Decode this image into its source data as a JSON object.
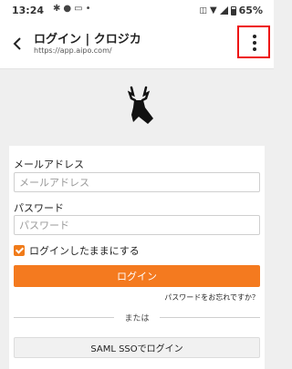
{
  "status_bar": {
    "time": "13:24",
    "battery": "65%",
    "left_icons": [
      "settings-icon",
      "chat-icon",
      "message-icon",
      "dot-icon"
    ],
    "right_icons": [
      "vibrate-icon",
      "wifi-icon",
      "signal-icon",
      "battery-icon"
    ]
  },
  "app_bar": {
    "title": "ログイン | クロジカ",
    "url": "https://app.aipo.com/"
  },
  "logo": {
    "icon": "deer-logo-icon"
  },
  "form": {
    "email_label": "メールアドレス",
    "email_placeholder": "メールアドレス",
    "password_label": "パスワード",
    "password_placeholder": "パスワード",
    "remember_label": "ログインしたままにする",
    "remember_checked": true,
    "login_button": "ログイン",
    "forgot_link": "パスワードをお忘れですか？",
    "divider_text": "または",
    "sso_button": "SAML SSOでログイン"
  },
  "colors": {
    "accent": "#f47a1f",
    "highlight_box": "#e11111",
    "background": "#efefef"
  }
}
